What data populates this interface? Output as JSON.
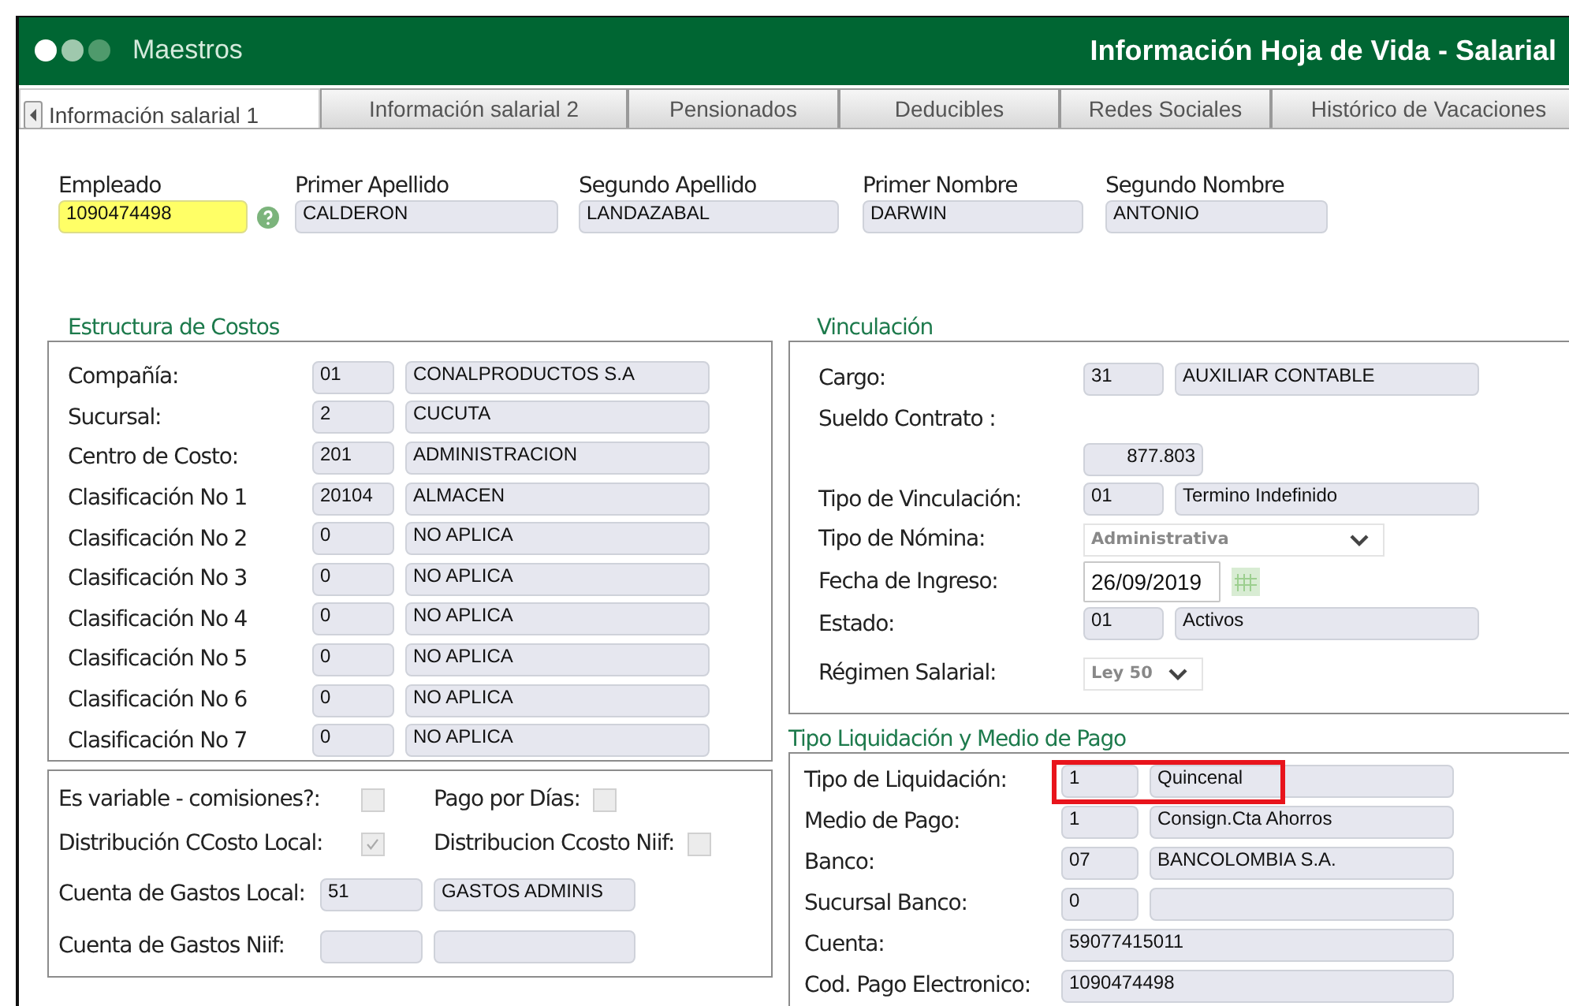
{
  "header": {
    "app": "Maestros",
    "title": "Información Hoja de Vida - Salarial"
  },
  "tabs": [
    {
      "label": "Información salarial 1",
      "selected": true
    },
    {
      "label": "Información salarial 2",
      "selected": false
    },
    {
      "label": "Pensionados",
      "selected": false
    },
    {
      "label": "Deducibles",
      "selected": false
    },
    {
      "label": "Redes Sociales",
      "selected": false
    },
    {
      "label": "Histórico de Vacaciones",
      "selected": false
    }
  ],
  "employee": [
    {
      "label": "Empleado",
      "value": "1090474498",
      "kind": "key"
    },
    {
      "label": "Primer Apellido",
      "value": "CALDERON",
      "kind": "text"
    },
    {
      "label": "Segundo Apellido",
      "value": "LANDAZABAL",
      "kind": "text"
    },
    {
      "label": "Primer Nombre",
      "value": "DARWIN",
      "kind": "text"
    },
    {
      "label": "Segundo Nombre",
      "value": "ANTONIO",
      "kind": "text"
    }
  ],
  "cost_structure": {
    "title": "Estructura de Costos",
    "rows": [
      {
        "kind": "pair",
        "label": "Compañía:",
        "code": "01",
        "name": "CONALPRODUCTOS S.A"
      },
      {
        "kind": "pair",
        "label": "Sucursal:",
        "code": "2",
        "name": "CUCUTA"
      },
      {
        "kind": "pair",
        "label": "Centro de Costo:",
        "code": "201",
        "name": "ADMINISTRACION"
      },
      {
        "kind": "pair",
        "label": "Clasificación No 1",
        "code": "20104",
        "name": "ALMACEN"
      },
      {
        "kind": "pair",
        "label": "Clasificación No 2",
        "code": "0",
        "name": "NO APLICA"
      },
      {
        "kind": "pair",
        "label": "Clasificación No 3",
        "code": "0",
        "name": "NO APLICA"
      },
      {
        "kind": "pair",
        "label": "Clasificación No 4",
        "code": "0",
        "name": "NO APLICA"
      },
      {
        "kind": "pair",
        "label": "Clasificación No 5",
        "code": "0",
        "name": "NO APLICA"
      },
      {
        "kind": "pair",
        "label": "Clasificación No 6",
        "code": "0",
        "name": "NO APLICA"
      },
      {
        "kind": "pair",
        "label": "Clasificación No 7",
        "code": "0",
        "name": "NO APLICA"
      }
    ]
  },
  "options": {
    "rows": [
      {
        "kind": "checks",
        "items": [
          {
            "label": "Es variable - comisiones?:",
            "checked": false
          },
          {
            "label": "Pago por Días:",
            "checked": false
          }
        ]
      },
      {
        "kind": "checks",
        "items": [
          {
            "label": "Distribución CCosto Local:",
            "checked": true
          },
          {
            "label": "Distribucion Ccosto Niif:",
            "checked": false
          }
        ]
      },
      {
        "kind": "pair",
        "label": "Cuenta de Gastos Local:",
        "code": "51",
        "name": "GASTOS ADMINIS"
      },
      {
        "kind": "pair",
        "label": "Cuenta de Gastos Niif:"
      }
    ]
  },
  "vinculacion": {
    "title": "Vinculación",
    "rows": [
      {
        "kind": "pair",
        "label": "Cargo:",
        "code": "31",
        "name": "AUXILIAR CONTABLE"
      },
      {
        "kind": "amount",
        "label": "Sueldo Contrato :",
        "value": "877.803"
      },
      {
        "kind": "pair",
        "label": "Tipo de Vinculación:",
        "code": "01",
        "name": "Termino Indefinido"
      },
      {
        "kind": "select",
        "label": "Tipo de Nómina:",
        "value": "Administrativa"
      },
      {
        "kind": "date",
        "label": "Fecha de Ingreso:",
        "value": "26/09/2019"
      },
      {
        "kind": "pair",
        "label": "Estado:",
        "code": "01",
        "name": "Activos"
      },
      {
        "kind": "select",
        "label": "Régimen Salarial:",
        "value": "Ley 50"
      }
    ]
  },
  "liquidacion": {
    "title": "Tipo Liquidación y Medio de Pago",
    "rows": [
      {
        "kind": "pair",
        "label": "Tipo de Liquidación:",
        "code": "1",
        "name": "Quincenal",
        "highlighted": true
      },
      {
        "kind": "pair",
        "label": "Medio de Pago:",
        "code": "1",
        "name": "Consign.Cta Ahorros",
        "highlighted": false
      },
      {
        "kind": "pair",
        "label": "Banco:",
        "code": "07",
        "name": "BANCOLOMBIA S.A.",
        "highlighted": false
      },
      {
        "kind": "pair",
        "label": "Sucursal Banco:",
        "code": "0",
        "highlighted": false
      },
      {
        "kind": "single",
        "label": "Cuenta:",
        "value": "59077415011",
        "highlighted": false
      },
      {
        "kind": "single",
        "label": "Cod. Pago Electronico:",
        "value": "1090474498",
        "highlighted": false
      }
    ]
  }
}
